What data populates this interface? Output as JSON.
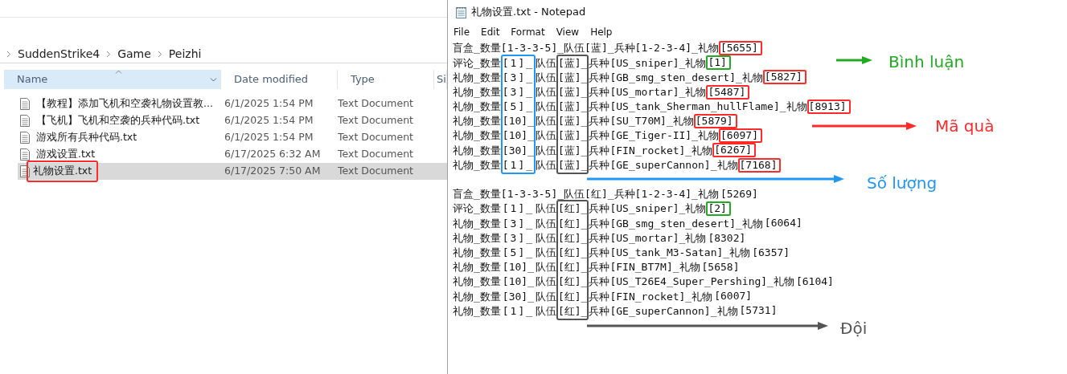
{
  "explorer": {
    "breadcrumb": [
      "SuddenStrike4",
      "Game",
      "Peizhi"
    ],
    "columns": [
      {
        "label": "Name",
        "selected": true
      },
      {
        "label": "Date modified",
        "selected": false
      },
      {
        "label": "Type",
        "selected": false
      },
      {
        "label": "Si",
        "selected": false
      }
    ],
    "files": [
      {
        "name": "【教程】添加飞机和空袭礼物设置教...",
        "date": "6/1/2025 1:54 PM",
        "type": "Text Document",
        "selected": false,
        "highlighted": false
      },
      {
        "name": "【飞机】飞机和空袭的兵种代码.txt",
        "date": "6/1/2025 1:54 PM",
        "type": "Text Document",
        "selected": false,
        "highlighted": false
      },
      {
        "name": "游戏所有兵种代码.txt",
        "date": "6/1/2025 1:54 PM",
        "type": "Text Document",
        "selected": false,
        "highlighted": false
      },
      {
        "name": "游戏设置.txt",
        "date": "6/17/2025 6:32 AM",
        "type": "Text Document",
        "selected": false,
        "highlighted": false
      },
      {
        "name": "礼物设置.txt",
        "date": "6/17/2025 7:50 AM",
        "type": "Text Document",
        "selected": true,
        "highlighted": true
      }
    ]
  },
  "notepad": {
    "title": "礼物设置.txt - Notepad",
    "menu": [
      "File",
      "Edit",
      "Format",
      "View",
      "Help"
    ],
    "blocks": [
      {
        "boxes": [
          {
            "kind": "count",
            "color": "#2196f3"
          },
          {
            "kind": "team",
            "color": "#555555"
          }
        ],
        "lines": [
          {
            "text": "盲盒_数量[1-3-3-5]_队伍[蓝]_兵种[1-2-3-4]_礼物",
            "gift": "[5655]",
            "color": "#ff2a2a"
          },
          {
            "text": "评论_数量[1]_队伍[蓝]_兵种[US_sniper]_礼物",
            "gift": "[1]",
            "color": "#22aa22"
          },
          {
            "text": "礼物_数量[3]_队伍[蓝]_兵种[GB_smg_sten_desert]_礼物",
            "gift": "[5827]",
            "color": "#ff2a2a"
          },
          {
            "text": "礼物_数量[3]_队伍[蓝]_兵种[US_mortar]_礼物",
            "gift": "[5487]",
            "color": "#ff2a2a"
          },
          {
            "text": "礼物_数量[5]_队伍[蓝]_兵种[US_tank_Sherman_hullFlame]_礼物",
            "gift": "[8913]",
            "color": "#ff2a2a"
          },
          {
            "text": "礼物_数量[10]_队伍[蓝]_兵种[SU_T70M]_礼物",
            "gift": "[5879]",
            "color": "#ff2a2a"
          },
          {
            "text": "礼物_数量[10]_队伍[蓝]_兵种[GE_Tiger-II]_礼物",
            "gift": "[6097]",
            "color": "#ff2a2a"
          },
          {
            "text": "礼物_数量[30]_队伍[蓝]_兵种[FIN_rocket]_礼物",
            "gift": "[6267]",
            "color": "#ff2a2a"
          },
          {
            "text": "礼物_数量[1]_队伍[蓝]_兵种[GE_superCannon]_礼物",
            "gift": "[7168]",
            "color": "#ff2a2a"
          }
        ]
      },
      {
        "boxes": [
          {
            "kind": "team",
            "color": "#555555"
          }
        ],
        "lines": [
          {
            "text": "盲盒_数量[1-3-3-5]_队伍[红]_兵种[1-2-3-4]_礼物",
            "gift": "[5269]"
          },
          {
            "text": "评论_数量[1]_队伍[红]_兵种[US_sniper]_礼物",
            "gift": "[2]",
            "color": "#22aa22"
          },
          {
            "text": "礼物_数量[3]_队伍[红]_兵种[GB_smg_sten_desert]_礼物",
            "gift": "[6064]"
          },
          {
            "text": "礼物_数量[3]_队伍[红]_兵种[US_mortar]_礼物",
            "gift": "[8302]"
          },
          {
            "text": "礼物_数量[5]_队伍[红]_兵种[US_tank_M3-Satan]_礼物",
            "gift": "[6357]"
          },
          {
            "text": "礼物_数量[10]_队伍[红]_兵种[FIN_BT7M]_礼物",
            "gift": "[5658]"
          },
          {
            "text": "礼物_数量[10]_队伍[红]_兵种[US_T26E4_Super_Pershing]_礼物",
            "gift": "[6104]"
          },
          {
            "text": "礼物_数量[30]_队伍[红]_兵种[FIN_rocket]_礼物",
            "gift": "[6007]"
          },
          {
            "text": "礼物_数量[1]_队伍[红]_兵种[GE_superCannon]_礼物",
            "gift": "[5731]"
          }
        ]
      }
    ]
  },
  "annotations": [
    {
      "label": "Bình luận",
      "color": "#22aa22"
    },
    {
      "label": "Mã quà",
      "color": "#ff2a2a"
    },
    {
      "label": "Số lượng",
      "color": "#2196f3"
    },
    {
      "label": "Đội",
      "color": "#555555"
    }
  ]
}
